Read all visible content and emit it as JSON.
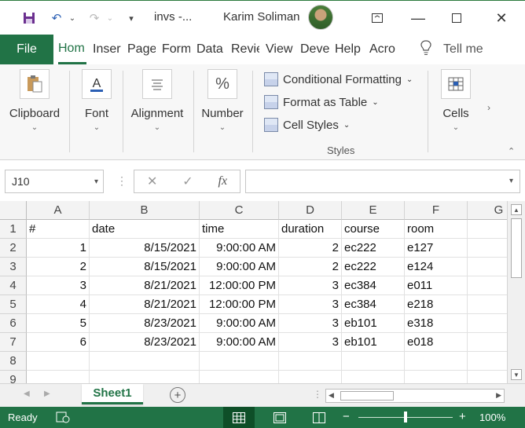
{
  "titlebar": {
    "filename": "invs  -...",
    "user": "Karim Soliman",
    "icons": [
      "save-icon",
      "undo-icon",
      "redo-icon",
      "customize-icon"
    ]
  },
  "ribbon_tabs": {
    "file": "File",
    "tabs": [
      "Hom",
      "Inser",
      "Page",
      "Form",
      "Data",
      "Revie",
      "View",
      "Deve",
      "Help",
      "Acro"
    ],
    "tell_me": "Tell me"
  },
  "ribbon": {
    "clipboard": "Clipboard",
    "font": "Font",
    "alignment": "Alignment",
    "number": "Number",
    "number_glyph": "%",
    "conditional_formatting": "Conditional Formatting",
    "format_as_table": "Format as Table",
    "cell_styles": "Cell Styles",
    "styles_group": "Styles",
    "cells": "Cells"
  },
  "formula_bar": {
    "name_box": "J10",
    "formula": "",
    "fx": "fx"
  },
  "grid": {
    "columns": [
      "A",
      "B",
      "C",
      "D",
      "E",
      "F",
      "G"
    ],
    "row_numbers": [
      "1",
      "2",
      "3",
      "4",
      "5",
      "6",
      "7",
      "8",
      "9"
    ],
    "rows": [
      [
        "#",
        "date",
        "time",
        "duration",
        "course",
        "room"
      ],
      [
        "1",
        "8/15/2021",
        "9:00:00 AM",
        "2",
        "ec222",
        "e127"
      ],
      [
        "2",
        "8/15/2021",
        "9:00:00 AM",
        "2",
        "ec222",
        "e124"
      ],
      [
        "3",
        "8/21/2021",
        "12:00:00 PM",
        "3",
        "ec384",
        "e011"
      ],
      [
        "4",
        "8/21/2021",
        "12:00:00 PM",
        "3",
        "ec384",
        "e218"
      ],
      [
        "5",
        "8/23/2021",
        "9:00:00 AM",
        "3",
        "eb101",
        "e318"
      ],
      [
        "6",
        "8/23/2021",
        "9:00:00 AM",
        "3",
        "eb101",
        "e018"
      ]
    ]
  },
  "sheets": {
    "active": "Sheet1"
  },
  "status": {
    "ready": "Ready",
    "zoom": "100%",
    "accent": "#217346"
  }
}
